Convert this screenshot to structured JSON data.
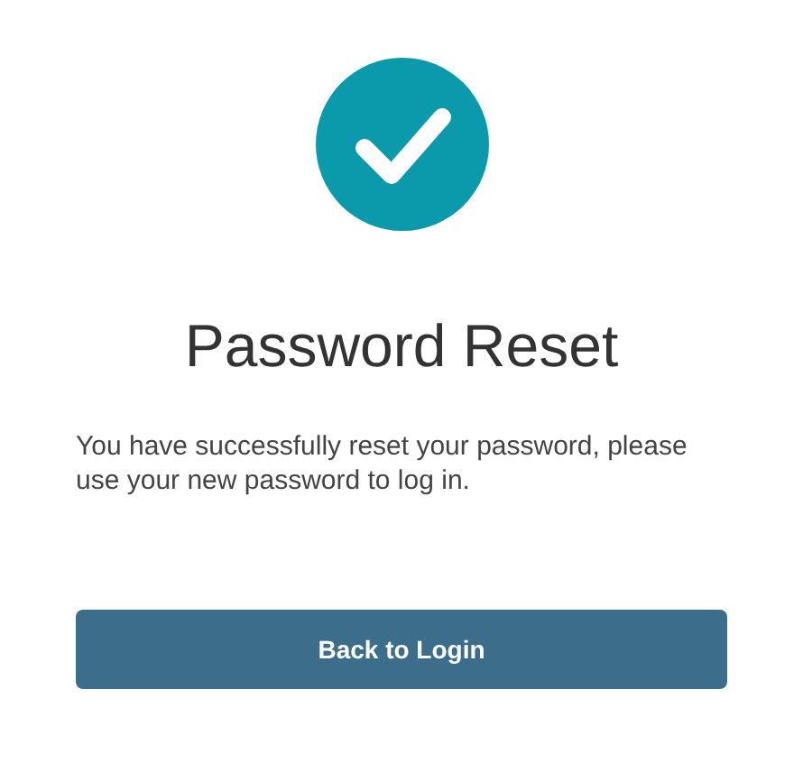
{
  "title": "Password Reset",
  "message": "You have successfully reset your password, please use your new password to log in.",
  "button": {
    "label": "Back to Login"
  }
}
